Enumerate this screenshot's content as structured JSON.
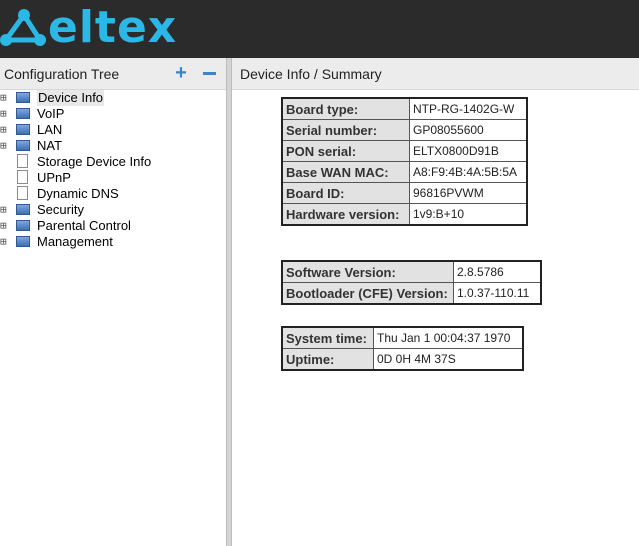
{
  "brand": {
    "logo_text": "eltex",
    "accent": "#2bb8e6"
  },
  "left_panel": {
    "title": "Configuration Tree",
    "expand_icon": "plus-icon",
    "collapse_icon": "minus-icon",
    "items": [
      {
        "label": "Device Info",
        "expandable": true,
        "selected": true
      },
      {
        "label": "VoIP",
        "expandable": true
      },
      {
        "label": "LAN",
        "expandable": true
      },
      {
        "label": "NAT",
        "expandable": true
      },
      {
        "label": "Storage Device Info",
        "expandable": false
      },
      {
        "label": "UPnP",
        "expandable": false
      },
      {
        "label": "Dynamic DNS",
        "expandable": false
      },
      {
        "label": "Security",
        "expandable": true
      },
      {
        "label": "Parental Control",
        "expandable": true
      },
      {
        "label": "Management",
        "expandable": true
      }
    ]
  },
  "right_panel": {
    "title": "Device Info / Summary"
  },
  "device_table": [
    {
      "key": "Board type:",
      "value": "NTP-RG-1402G-W"
    },
    {
      "key": "Serial number:",
      "value": "GP08055600"
    },
    {
      "key": "PON serial:",
      "value": "ELTX0800D91B"
    },
    {
      "key": "Base WAN MAC:",
      "value": "A8:F9:4B:4A:5B:5A"
    },
    {
      "key": "Board ID:",
      "value": "96816PVWM"
    },
    {
      "key": "Hardware version:",
      "value": "1v9:B+10"
    }
  ],
  "software_table": [
    {
      "key": "Software Version:",
      "value": "2.8.5786"
    },
    {
      "key": "Bootloader (CFE) Version:",
      "value": "1.0.37-110.11"
    }
  ],
  "time_table": [
    {
      "key": "System time:",
      "value": "Thu Jan 1 00:04:37 1970"
    },
    {
      "key": "Uptime:",
      "value": "0D 0H 4M 37S"
    }
  ]
}
